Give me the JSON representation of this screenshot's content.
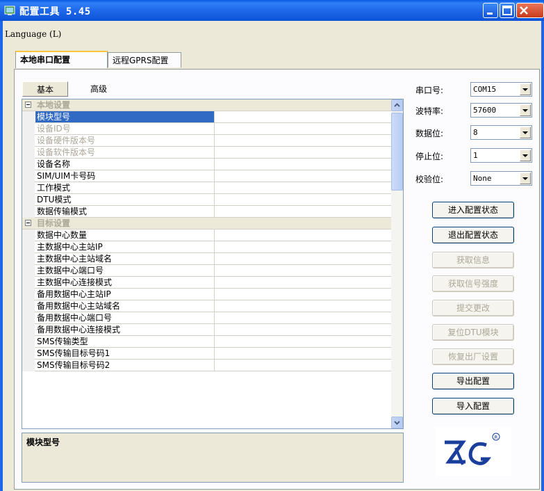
{
  "window": {
    "title": "配置工具 5.45"
  },
  "menu": {
    "language": "Language (L)"
  },
  "tabs": [
    {
      "label": "本地串口配置"
    },
    {
      "label": "远程GPRS配置"
    }
  ],
  "subtabs": [
    {
      "label": "基本"
    },
    {
      "label": "高级"
    }
  ],
  "grid": {
    "rows": [
      {
        "label": "本地设置"
      },
      {
        "label": "模块型号"
      },
      {
        "label": "设备ID号"
      },
      {
        "label": "设备硬件版本号"
      },
      {
        "label": "设备软件版本号"
      },
      {
        "label": "设备名称"
      },
      {
        "label": "SIM/UIM卡号码"
      },
      {
        "label": "工作模式"
      },
      {
        "label": "DTU模式"
      },
      {
        "label": "数据传输模式"
      },
      {
        "label": "目标设置"
      },
      {
        "label": "数据中心数量"
      },
      {
        "label": "主数据中心主站IP"
      },
      {
        "label": "主数据中心主站域名"
      },
      {
        "label": "主数据中心端口号"
      },
      {
        "label": "主数据中心连接模式"
      },
      {
        "label": "备用数据中心主站IP"
      },
      {
        "label": "备用数据中心主站域名"
      },
      {
        "label": "备用数据中心端口号"
      },
      {
        "label": "备用数据中心连接模式"
      },
      {
        "label": "SMS传输类型"
      },
      {
        "label": "SMS传输目标号码1"
      },
      {
        "label": "SMS传输目标号码2"
      }
    ]
  },
  "description": {
    "title": "模块型号"
  },
  "serial": {
    "port_label": "串口号:",
    "port_value": "COM15",
    "baud_label": "波特率:",
    "baud_value": "57600",
    "data_label": "数据位:",
    "data_value": "8",
    "stop_label": "停止位:",
    "stop_value": "1",
    "parity_label": "校验位:",
    "parity_value": "None"
  },
  "buttons": {
    "enter_config": "进入配置状态",
    "exit_config": "退出配置状态",
    "get_info": "获取信息",
    "get_signal": "获取信号强度",
    "submit": "提交更改",
    "reset_dtu": "复位DTU模块",
    "factory_reset": "恢复出厂设置",
    "export": "导出配置",
    "import": "导入配置"
  },
  "logo": {
    "text": "ZLG",
    "registered": "®"
  }
}
